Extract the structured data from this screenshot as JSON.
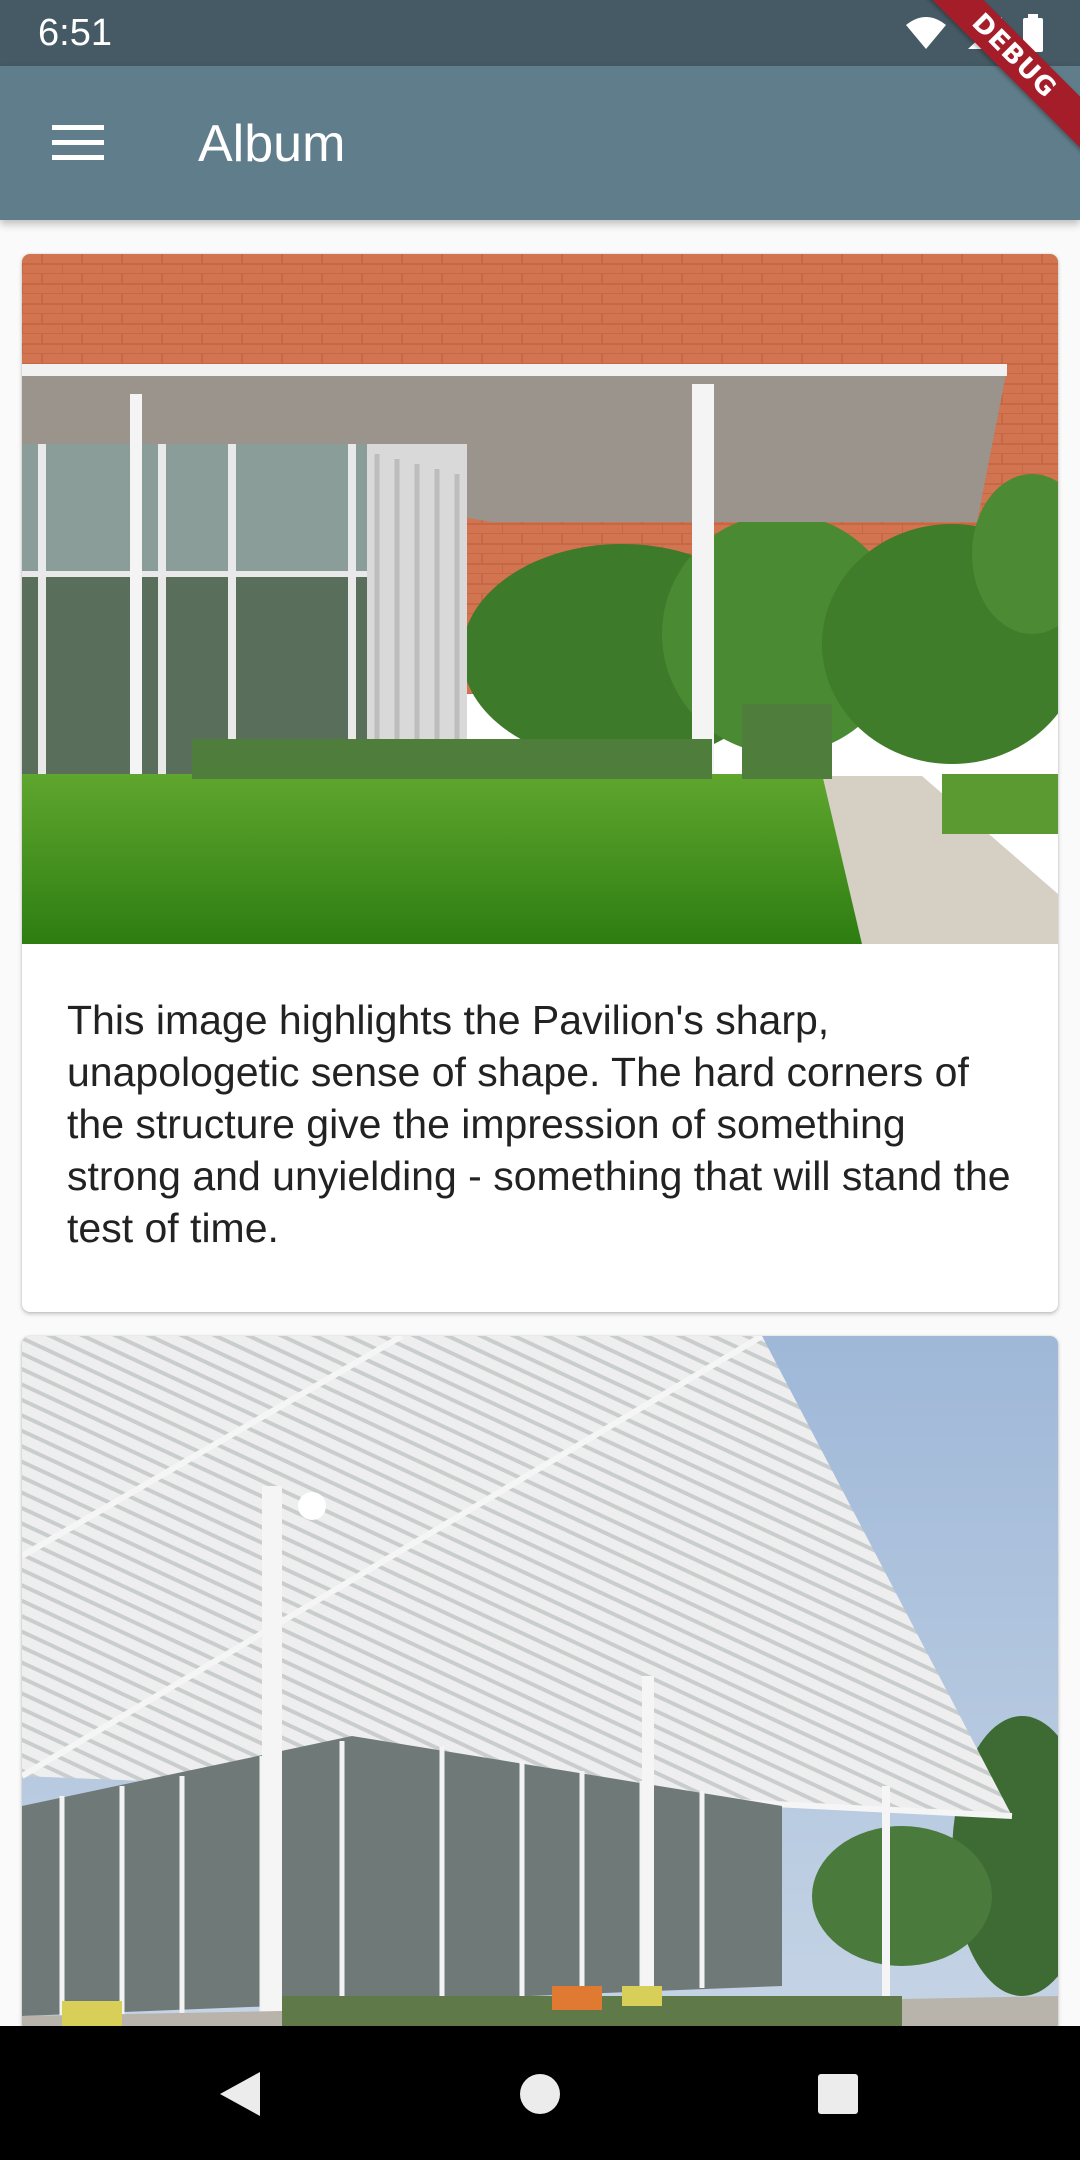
{
  "status_bar": {
    "time": "6:51",
    "icons": [
      "wifi-icon",
      "signal-icon",
      "battery-icon"
    ],
    "debug_banner": "DEBUG"
  },
  "app_bar": {
    "title": "Album",
    "menu_icon": "menu-icon",
    "background": "#607d8b",
    "status_background": "#455a64"
  },
  "cards": [
    {
      "image": "pavilion-exterior-photo",
      "description": "This image highlights the Pavilion's sharp, unapologetic sense of shape. The hard corners of the structure give the impression of something strong and unyielding - something that will stand the test of time."
    },
    {
      "image": "pavilion-canopy-photo"
    }
  ],
  "nav_bar": {
    "buttons": [
      "back-icon",
      "home-icon",
      "recents-icon"
    ]
  }
}
